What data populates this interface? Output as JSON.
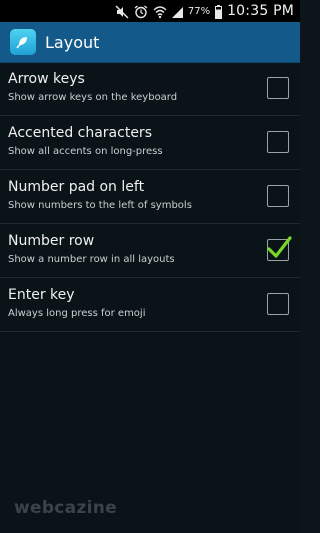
{
  "status_bar": {
    "battery_percent": "77%",
    "time": "10:35 PM",
    "icons": [
      "mute-icon",
      "alarm-icon",
      "wifi-icon",
      "signal-icon",
      "battery-icon"
    ]
  },
  "action_bar": {
    "title": "Layout",
    "app_icon": "swiftkey-icon",
    "color": "#13598a"
  },
  "settings": [
    {
      "title": "Arrow keys",
      "subtitle": "Show arrow keys on the keyboard",
      "checked": false
    },
    {
      "title": "Accented characters",
      "subtitle": "Show all accents on long-press",
      "checked": false
    },
    {
      "title": "Number pad on left",
      "subtitle": "Show numbers to the left of symbols",
      "checked": false
    },
    {
      "title": "Number row",
      "subtitle": "Show a number row in all layouts",
      "checked": true
    },
    {
      "title": "Enter key",
      "subtitle": "Always long press for emoji",
      "checked": false
    }
  ],
  "watermark": "webcazine",
  "colors": {
    "checkmark": "#7bd62a",
    "background": "#0a1418"
  }
}
